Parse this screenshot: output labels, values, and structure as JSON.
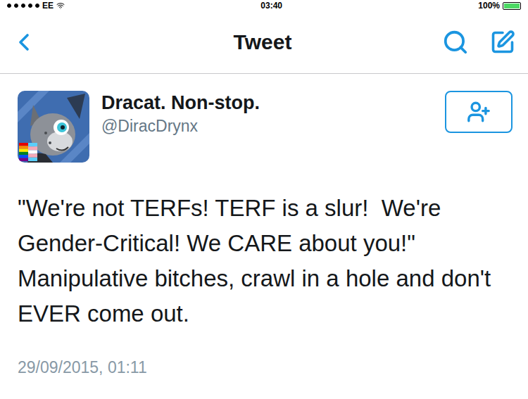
{
  "status_bar": {
    "carrier": "EE",
    "signal_bars": 5,
    "time": "03:40",
    "battery": "100%",
    "battery_level": 1
  },
  "nav": {
    "title": "Tweet"
  },
  "tweet": {
    "display_name": "Dracat. Non-stop.",
    "handle": "@DiracDrynx",
    "following": false,
    "text": "\"We're not TERFs! TERF is a slur!  We're Gender-Critical! We CARE about you!\" Manipulative bitches, crawl in a hole and don't EVER come out.",
    "timestamp": "29/09/2015, 01:11"
  }
}
